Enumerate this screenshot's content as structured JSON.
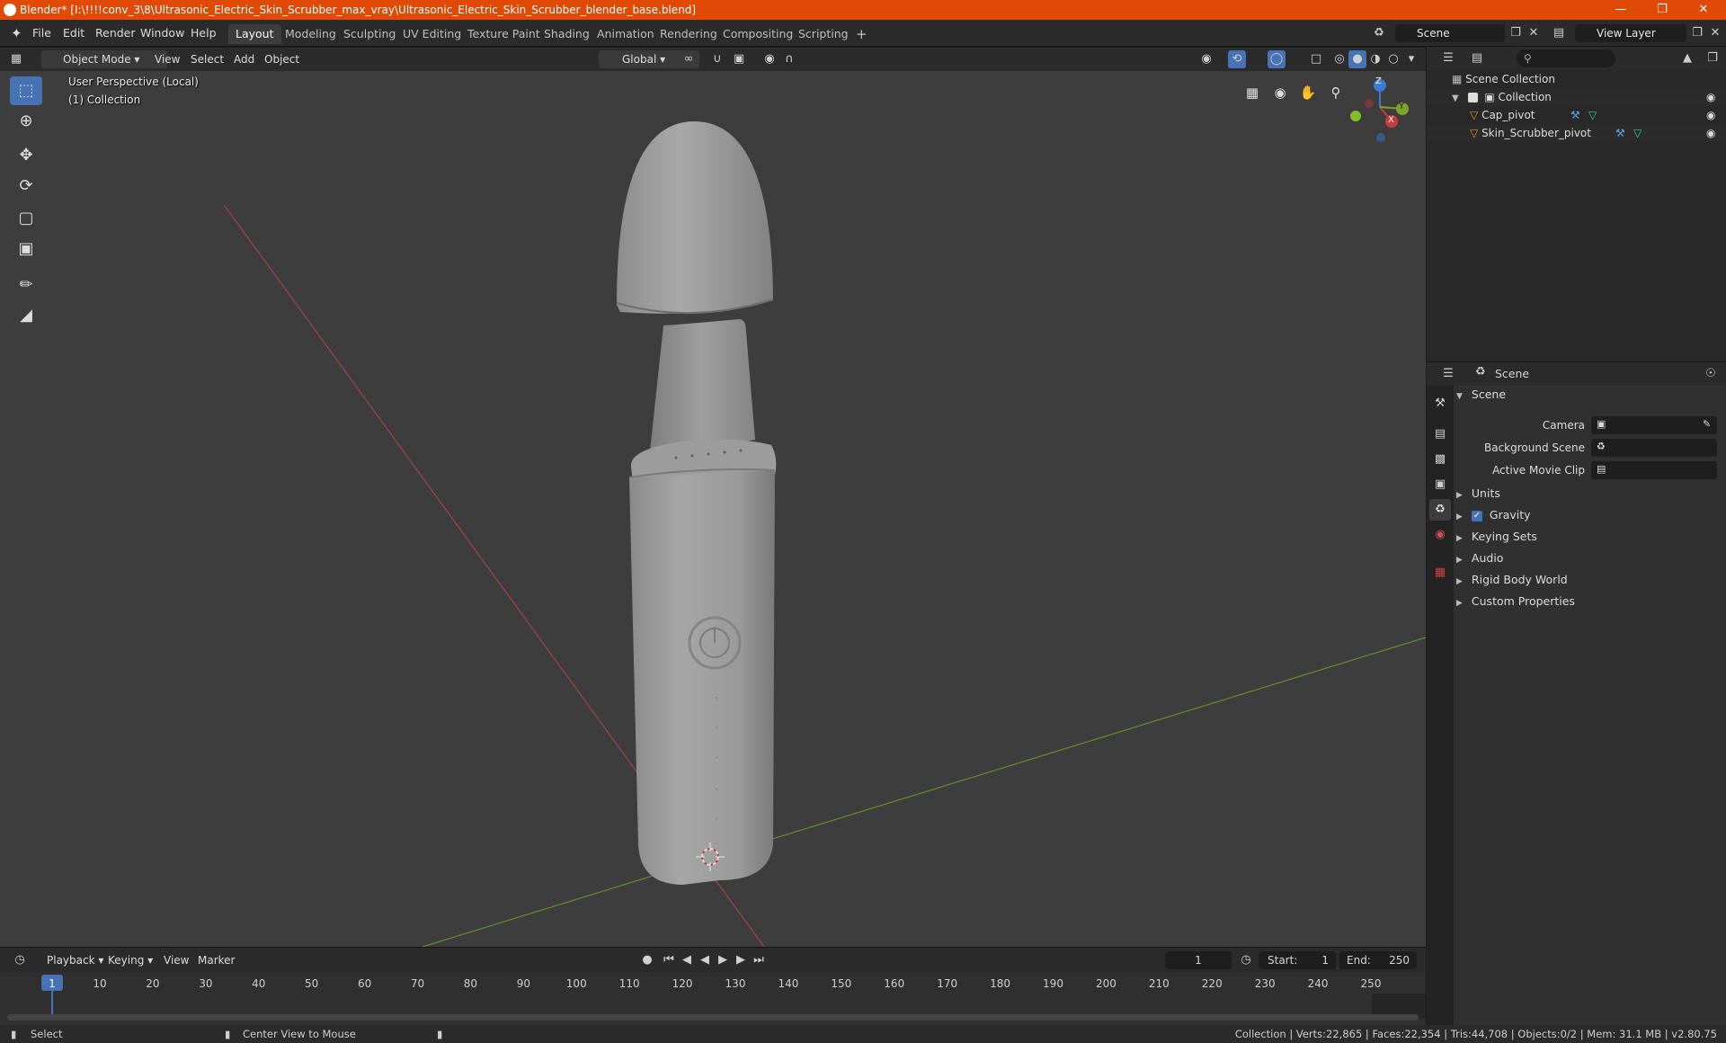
{
  "window": {
    "title": "Blender* [I:\\!!!!conv_3\\8\\Ultrasonic_Electric_Skin_Scrubber_max_vray\\Ultrasonic_Electric_Skin_Scrubber_blender_base.blend]",
    "accent_color": "#e04a06"
  },
  "menu": {
    "file": "File",
    "edit": "Edit",
    "render": "Render",
    "window": "Window",
    "help": "Help"
  },
  "workspaces": [
    "Layout",
    "Modeling",
    "Sculpting",
    "UV Editing",
    "Texture Paint",
    "Shading",
    "Animation",
    "Rendering",
    "Compositing",
    "Scripting"
  ],
  "active_workspace": "Layout",
  "scene_selector": "Scene",
  "view_layer_selector": "View Layer",
  "viewport_header": {
    "mode": "Object Mode",
    "view": "View",
    "select": "Select",
    "add": "Add",
    "object": "Object",
    "transform_orientation": "Global"
  },
  "viewport": {
    "perspective_label": "User Perspective (Local)",
    "collection_label": "(1) Collection",
    "gizmo_axes": {
      "x": "X",
      "y": "Y",
      "z": "Z"
    },
    "active_tool": "select-box"
  },
  "outliner": {
    "root": "Scene Collection",
    "collection": "Collection",
    "objects": [
      "Cap_pivot",
      "Skin_Scrubber_pivot"
    ]
  },
  "properties": {
    "header_title": "Scene",
    "panel_scene": "Scene",
    "camera_label": "Camera",
    "background_scene_label": "Background Scene",
    "active_movie_clip_label": "Active Movie Clip",
    "sections": [
      "Units",
      "Gravity",
      "Keying Sets",
      "Audio",
      "Rigid Body World",
      "Custom Properties"
    ],
    "gravity_enabled": true
  },
  "timeline": {
    "playback": "Playback",
    "keying": "Keying",
    "view": "View",
    "marker": "Marker",
    "current_frame": "1",
    "start_label": "Start:",
    "start_value": "1",
    "end_label": "End:",
    "end_value": "250",
    "ticks": [
      "1",
      "10",
      "20",
      "30",
      "40",
      "50",
      "60",
      "70",
      "80",
      "90",
      "100",
      "110",
      "120",
      "130",
      "140",
      "150",
      "160",
      "170",
      "180",
      "190",
      "200",
      "210",
      "220",
      "230",
      "240",
      "250"
    ]
  },
  "statusbar": {
    "select": "Select",
    "center_view": "Center View to Mouse",
    "stats": "Collection | Verts:22,865 | Faces:22,354 | Tris:44,708 | Objects:0/2 | Mem: 31.1 MB | v2.80.75"
  }
}
